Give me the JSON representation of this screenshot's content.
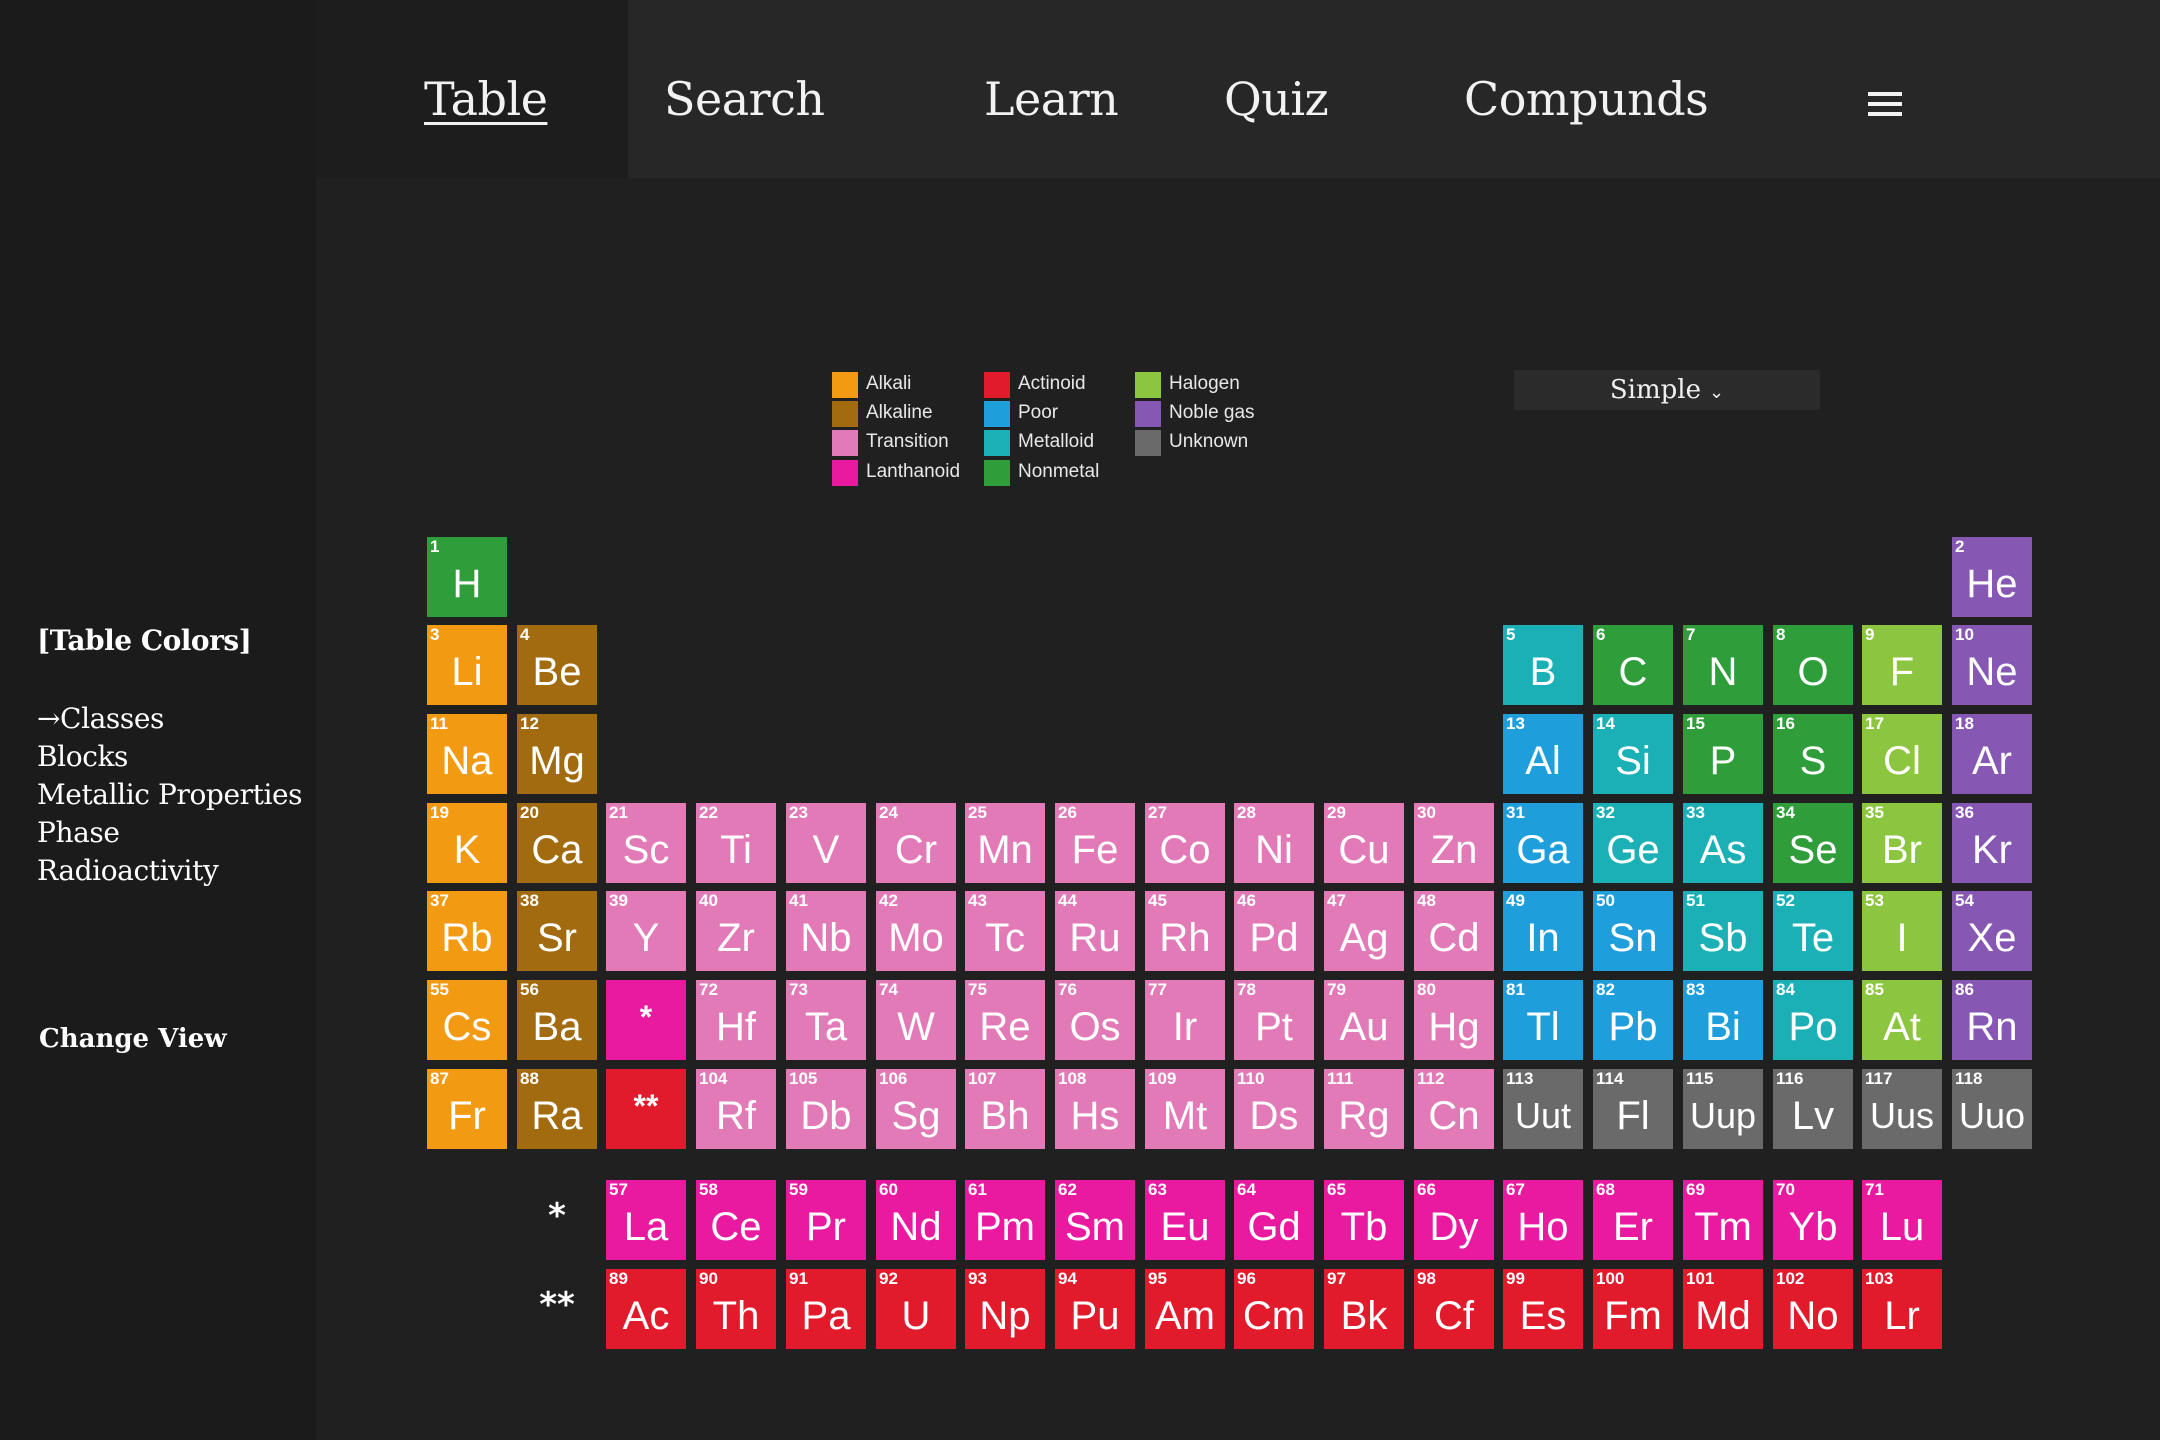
{
  "nav": {
    "items": [
      {
        "label": "Table",
        "active": true
      },
      {
        "label": "Search",
        "active": false
      },
      {
        "label": "Learn",
        "active": false
      },
      {
        "label": "Quiz",
        "active": false
      },
      {
        "label": "Compunds",
        "active": false
      }
    ],
    "menu_icon": "hamburger-menu-icon"
  },
  "sidebar": {
    "title": "[Table Colors]",
    "options": [
      "→Classes",
      "Blocks",
      "Metallic Properties",
      "Phase",
      "Radioactivity"
    ],
    "change_view": "Change View"
  },
  "view_select": {
    "value": "Simple",
    "chevron": "⌄"
  },
  "colors": {
    "alkali": "#f39a13",
    "alkaline": "#a26b0f",
    "transition": "#e37ab8",
    "lanthanoid": "#ea1aa0",
    "actinoid": "#e21b2c",
    "poor": "#1e9fdb",
    "metalloid": "#1ab0b5",
    "nonmetal": "#2e9d3a",
    "halogen": "#8cc53f",
    "noble": "#8657b3",
    "unknown": "#6a6a6a"
  },
  "legend": [
    {
      "key": "alkali",
      "label": "Alkali"
    },
    {
      "key": "alkaline",
      "label": "Alkaline"
    },
    {
      "key": "transition",
      "label": "Transition"
    },
    {
      "key": "lanthanoid",
      "label": "Lanthanoid"
    },
    {
      "key": "actinoid",
      "label": "Actinoid"
    },
    {
      "key": "poor",
      "label": "Poor"
    },
    {
      "key": "metalloid",
      "label": "Metalloid"
    },
    {
      "key": "nonmetal",
      "label": "Nonmetal"
    },
    {
      "key": "halogen",
      "label": "Halogen"
    },
    {
      "key": "noble",
      "label": "Noble gas"
    },
    {
      "key": "unknown",
      "label": "Unknown"
    }
  ],
  "elements": [
    {
      "n": 1,
      "s": "H",
      "c": "nonmetal",
      "r": 1,
      "g": 1
    },
    {
      "n": 2,
      "s": "He",
      "c": "noble",
      "r": 1,
      "g": 18
    },
    {
      "n": 3,
      "s": "Li",
      "c": "alkali",
      "r": 2,
      "g": 1
    },
    {
      "n": 4,
      "s": "Be",
      "c": "alkaline",
      "r": 2,
      "g": 2
    },
    {
      "n": 5,
      "s": "B",
      "c": "metalloid",
      "r": 2,
      "g": 13
    },
    {
      "n": 6,
      "s": "C",
      "c": "nonmetal",
      "r": 2,
      "g": 14
    },
    {
      "n": 7,
      "s": "N",
      "c": "nonmetal",
      "r": 2,
      "g": 15
    },
    {
      "n": 8,
      "s": "O",
      "c": "nonmetal",
      "r": 2,
      "g": 16
    },
    {
      "n": 9,
      "s": "F",
      "c": "halogen",
      "r": 2,
      "g": 17
    },
    {
      "n": 10,
      "s": "Ne",
      "c": "noble",
      "r": 2,
      "g": 18
    },
    {
      "n": 11,
      "s": "Na",
      "c": "alkali",
      "r": 3,
      "g": 1
    },
    {
      "n": 12,
      "s": "Mg",
      "c": "alkaline",
      "r": 3,
      "g": 2
    },
    {
      "n": 13,
      "s": "Al",
      "c": "poor",
      "r": 3,
      "g": 13
    },
    {
      "n": 14,
      "s": "Si",
      "c": "metalloid",
      "r": 3,
      "g": 14
    },
    {
      "n": 15,
      "s": "P",
      "c": "nonmetal",
      "r": 3,
      "g": 15
    },
    {
      "n": 16,
      "s": "S",
      "c": "nonmetal",
      "r": 3,
      "g": 16
    },
    {
      "n": 17,
      "s": "Cl",
      "c": "halogen",
      "r": 3,
      "g": 17
    },
    {
      "n": 18,
      "s": "Ar",
      "c": "noble",
      "r": 3,
      "g": 18
    },
    {
      "n": 19,
      "s": "K",
      "c": "alkali",
      "r": 4,
      "g": 1
    },
    {
      "n": 20,
      "s": "Ca",
      "c": "alkaline",
      "r": 4,
      "g": 2
    },
    {
      "n": 21,
      "s": "Sc",
      "c": "transition",
      "r": 4,
      "g": 3
    },
    {
      "n": 22,
      "s": "Ti",
      "c": "transition",
      "r": 4,
      "g": 4
    },
    {
      "n": 23,
      "s": "V",
      "c": "transition",
      "r": 4,
      "g": 5
    },
    {
      "n": 24,
      "s": "Cr",
      "c": "transition",
      "r": 4,
      "g": 6
    },
    {
      "n": 25,
      "s": "Mn",
      "c": "transition",
      "r": 4,
      "g": 7
    },
    {
      "n": 26,
      "s": "Fe",
      "c": "transition",
      "r": 4,
      "g": 8
    },
    {
      "n": 27,
      "s": "Co",
      "c": "transition",
      "r": 4,
      "g": 9
    },
    {
      "n": 28,
      "s": "Ni",
      "c": "transition",
      "r": 4,
      "g": 10
    },
    {
      "n": 29,
      "s": "Cu",
      "c": "transition",
      "r": 4,
      "g": 11
    },
    {
      "n": 30,
      "s": "Zn",
      "c": "transition",
      "r": 4,
      "g": 12
    },
    {
      "n": 31,
      "s": "Ga",
      "c": "poor",
      "r": 4,
      "g": 13
    },
    {
      "n": 32,
      "s": "Ge",
      "c": "metalloid",
      "r": 4,
      "g": 14
    },
    {
      "n": 33,
      "s": "As",
      "c": "metalloid",
      "r": 4,
      "g": 15
    },
    {
      "n": 34,
      "s": "Se",
      "c": "nonmetal",
      "r": 4,
      "g": 16
    },
    {
      "n": 35,
      "s": "Br",
      "c": "halogen",
      "r": 4,
      "g": 17
    },
    {
      "n": 36,
      "s": "Kr",
      "c": "noble",
      "r": 4,
      "g": 18
    },
    {
      "n": 37,
      "s": "Rb",
      "c": "alkali",
      "r": 5,
      "g": 1
    },
    {
      "n": 38,
      "s": "Sr",
      "c": "alkaline",
      "r": 5,
      "g": 2
    },
    {
      "n": 39,
      "s": "Y",
      "c": "transition",
      "r": 5,
      "g": 3
    },
    {
      "n": 40,
      "s": "Zr",
      "c": "transition",
      "r": 5,
      "g": 4
    },
    {
      "n": 41,
      "s": "Nb",
      "c": "transition",
      "r": 5,
      "g": 5
    },
    {
      "n": 42,
      "s": "Mo",
      "c": "transition",
      "r": 5,
      "g": 6
    },
    {
      "n": 43,
      "s": "Tc",
      "c": "transition",
      "r": 5,
      "g": 7
    },
    {
      "n": 44,
      "s": "Ru",
      "c": "transition",
      "r": 5,
      "g": 8
    },
    {
      "n": 45,
      "s": "Rh",
      "c": "transition",
      "r": 5,
      "g": 9
    },
    {
      "n": 46,
      "s": "Pd",
      "c": "transition",
      "r": 5,
      "g": 10
    },
    {
      "n": 47,
      "s": "Ag",
      "c": "transition",
      "r": 5,
      "g": 11
    },
    {
      "n": 48,
      "s": "Cd",
      "c": "transition",
      "r": 5,
      "g": 12
    },
    {
      "n": 49,
      "s": "In",
      "c": "poor",
      "r": 5,
      "g": 13
    },
    {
      "n": 50,
      "s": "Sn",
      "c": "poor",
      "r": 5,
      "g": 14
    },
    {
      "n": 51,
      "s": "Sb",
      "c": "metalloid",
      "r": 5,
      "g": 15
    },
    {
      "n": 52,
      "s": "Te",
      "c": "metalloid",
      "r": 5,
      "g": 16
    },
    {
      "n": 53,
      "s": "I",
      "c": "halogen",
      "r": 5,
      "g": 17
    },
    {
      "n": 54,
      "s": "Xe",
      "c": "noble",
      "r": 5,
      "g": 18
    },
    {
      "n": 55,
      "s": "Cs",
      "c": "alkali",
      "r": 6,
      "g": 1
    },
    {
      "n": 56,
      "s": "Ba",
      "c": "alkaline",
      "r": 6,
      "g": 2
    },
    {
      "n": null,
      "s": "*",
      "c": "lanthanoid",
      "r": 6,
      "g": 3
    },
    {
      "n": 72,
      "s": "Hf",
      "c": "transition",
      "r": 6,
      "g": 4
    },
    {
      "n": 73,
      "s": "Ta",
      "c": "transition",
      "r": 6,
      "g": 5
    },
    {
      "n": 74,
      "s": "W",
      "c": "transition",
      "r": 6,
      "g": 6
    },
    {
      "n": 75,
      "s": "Re",
      "c": "transition",
      "r": 6,
      "g": 7
    },
    {
      "n": 76,
      "s": "Os",
      "c": "transition",
      "r": 6,
      "g": 8
    },
    {
      "n": 77,
      "s": "Ir",
      "c": "transition",
      "r": 6,
      "g": 9
    },
    {
      "n": 78,
      "s": "Pt",
      "c": "transition",
      "r": 6,
      "g": 10
    },
    {
      "n": 79,
      "s": "Au",
      "c": "transition",
      "r": 6,
      "g": 11
    },
    {
      "n": 80,
      "s": "Hg",
      "c": "transition",
      "r": 6,
      "g": 12
    },
    {
      "n": 81,
      "s": "Tl",
      "c": "poor",
      "r": 6,
      "g": 13
    },
    {
      "n": 82,
      "s": "Pb",
      "c": "poor",
      "r": 6,
      "g": 14
    },
    {
      "n": 83,
      "s": "Bi",
      "c": "poor",
      "r": 6,
      "g": 15
    },
    {
      "n": 84,
      "s": "Po",
      "c": "metalloid",
      "r": 6,
      "g": 16
    },
    {
      "n": 85,
      "s": "At",
      "c": "halogen",
      "r": 6,
      "g": 17
    },
    {
      "n": 86,
      "s": "Rn",
      "c": "noble",
      "r": 6,
      "g": 18
    },
    {
      "n": 87,
      "s": "Fr",
      "c": "alkali",
      "r": 7,
      "g": 1
    },
    {
      "n": 88,
      "s": "Ra",
      "c": "alkaline",
      "r": 7,
      "g": 2
    },
    {
      "n": null,
      "s": "**",
      "c": "actinoid",
      "r": 7,
      "g": 3
    },
    {
      "n": 104,
      "s": "Rf",
      "c": "transition",
      "r": 7,
      "g": 4
    },
    {
      "n": 105,
      "s": "Db",
      "c": "transition",
      "r": 7,
      "g": 5
    },
    {
      "n": 106,
      "s": "Sg",
      "c": "transition",
      "r": 7,
      "g": 6
    },
    {
      "n": 107,
      "s": "Bh",
      "c": "transition",
      "r": 7,
      "g": 7
    },
    {
      "n": 108,
      "s": "Hs",
      "c": "transition",
      "r": 7,
      "g": 8
    },
    {
      "n": 109,
      "s": "Mt",
      "c": "transition",
      "r": 7,
      "g": 9
    },
    {
      "n": 110,
      "s": "Ds",
      "c": "transition",
      "r": 7,
      "g": 10
    },
    {
      "n": 111,
      "s": "Rg",
      "c": "transition",
      "r": 7,
      "g": 11
    },
    {
      "n": 112,
      "s": "Cn",
      "c": "transition",
      "r": 7,
      "g": 12
    },
    {
      "n": 113,
      "s": "Uut",
      "c": "unknown",
      "r": 7,
      "g": 13
    },
    {
      "n": 114,
      "s": "Fl",
      "c": "unknown",
      "r": 7,
      "g": 14
    },
    {
      "n": 115,
      "s": "Uup",
      "c": "unknown",
      "r": 7,
      "g": 15
    },
    {
      "n": 116,
      "s": "Lv",
      "c": "unknown",
      "r": 7,
      "g": 16
    },
    {
      "n": 117,
      "s": "Uus",
      "c": "unknown",
      "r": 7,
      "g": 17
    },
    {
      "n": 118,
      "s": "Uuo",
      "c": "unknown",
      "r": 7,
      "g": 18
    },
    {
      "n": 57,
      "s": "La",
      "c": "lanthanoid",
      "r": 9,
      "g": 3
    },
    {
      "n": 58,
      "s": "Ce",
      "c": "lanthanoid",
      "r": 9,
      "g": 4
    },
    {
      "n": 59,
      "s": "Pr",
      "c": "lanthanoid",
      "r": 9,
      "g": 5
    },
    {
      "n": 60,
      "s": "Nd",
      "c": "lanthanoid",
      "r": 9,
      "g": 6
    },
    {
      "n": 61,
      "s": "Pm",
      "c": "lanthanoid",
      "r": 9,
      "g": 7
    },
    {
      "n": 62,
      "s": "Sm",
      "c": "lanthanoid",
      "r": 9,
      "g": 8
    },
    {
      "n": 63,
      "s": "Eu",
      "c": "lanthanoid",
      "r": 9,
      "g": 9
    },
    {
      "n": 64,
      "s": "Gd",
      "c": "lanthanoid",
      "r": 9,
      "g": 10
    },
    {
      "n": 65,
      "s": "Tb",
      "c": "lanthanoid",
      "r": 9,
      "g": 11
    },
    {
      "n": 66,
      "s": "Dy",
      "c": "lanthanoid",
      "r": 9,
      "g": 12
    },
    {
      "n": 67,
      "s": "Ho",
      "c": "lanthanoid",
      "r": 9,
      "g": 13
    },
    {
      "n": 68,
      "s": "Er",
      "c": "lanthanoid",
      "r": 9,
      "g": 14
    },
    {
      "n": 69,
      "s": "Tm",
      "c": "lanthanoid",
      "r": 9,
      "g": 15
    },
    {
      "n": 70,
      "s": "Yb",
      "c": "lanthanoid",
      "r": 9,
      "g": 16
    },
    {
      "n": 71,
      "s": "Lu",
      "c": "lanthanoid",
      "r": 9,
      "g": 17
    },
    {
      "n": 89,
      "s": "Ac",
      "c": "actinoid",
      "r": 10,
      "g": 3
    },
    {
      "n": 90,
      "s": "Th",
      "c": "actinoid",
      "r": 10,
      "g": 4
    },
    {
      "n": 91,
      "s": "Pa",
      "c": "actinoid",
      "r": 10,
      "g": 5
    },
    {
      "n": 92,
      "s": "U",
      "c": "actinoid",
      "r": 10,
      "g": 6
    },
    {
      "n": 93,
      "s": "Np",
      "c": "actinoid",
      "r": 10,
      "g": 7
    },
    {
      "n": 94,
      "s": "Pu",
      "c": "actinoid",
      "r": 10,
      "g": 8
    },
    {
      "n": 95,
      "s": "Am",
      "c": "actinoid",
      "r": 10,
      "g": 9
    },
    {
      "n": 96,
      "s": "Cm",
      "c": "actinoid",
      "r": 10,
      "g": 10
    },
    {
      "n": 97,
      "s": "Bk",
      "c": "actinoid",
      "r": 10,
      "g": 11
    },
    {
      "n": 98,
      "s": "Cf",
      "c": "actinoid",
      "r": 10,
      "g": 12
    },
    {
      "n": 99,
      "s": "Es",
      "c": "actinoid",
      "r": 10,
      "g": 13
    },
    {
      "n": 100,
      "s": "Fm",
      "c": "actinoid",
      "r": 10,
      "g": 14
    },
    {
      "n": 101,
      "s": "Md",
      "c": "actinoid",
      "r": 10,
      "g": 15
    },
    {
      "n": 102,
      "s": "No",
      "c": "actinoid",
      "r": 10,
      "g": 16
    },
    {
      "n": 103,
      "s": "Lr",
      "c": "actinoid",
      "r": 10,
      "g": 17
    }
  ],
  "series_markers": [
    {
      "label": "*",
      "r": 9
    },
    {
      "label": "**",
      "r": 10
    }
  ]
}
